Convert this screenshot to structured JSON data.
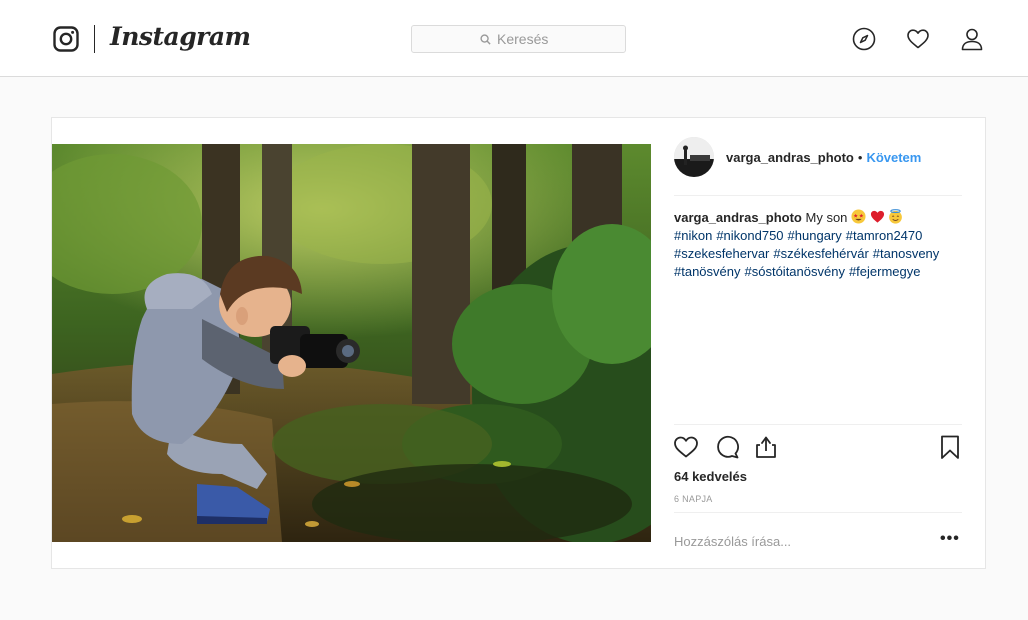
{
  "header": {
    "logo_text": "Instagram",
    "search_placeholder": "Keresés"
  },
  "post": {
    "username": "varga_andras_photo",
    "separator": "•",
    "follow_label": "Követem",
    "caption": {
      "username": "varga_andras_photo",
      "text": "My son",
      "emojis": [
        "star-struck-emoji",
        "red-heart-emoji",
        "smiling-face-with-halo-emoji"
      ],
      "hashtags": [
        "#nikon",
        "#nikond750",
        "#hungary",
        "#tamron2470",
        "#szekesfehervar",
        "#székesfehérvár",
        "#tanosveny",
        "#tanösvény",
        "#sóstóitanösvény",
        "#fejermegye"
      ]
    },
    "likes": "64 kedvelés",
    "time": "6 NAPJA",
    "comment_placeholder": "Hozzászólás írása...",
    "more_label": "•••"
  },
  "colors": {
    "link_blue": "#3897f0",
    "hashtag_blue": "#003569",
    "border": "#dbdbdb",
    "background": "#fafafa"
  }
}
